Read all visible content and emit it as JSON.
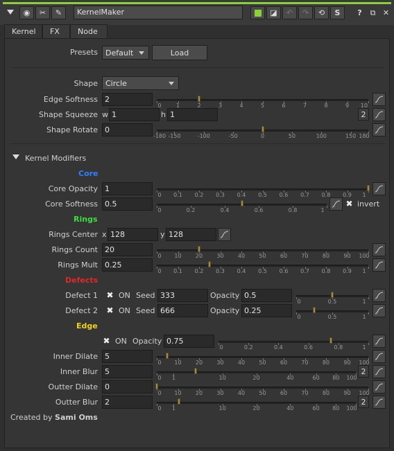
{
  "title_bar": {
    "node_name": "KernelMaker",
    "help": "?",
    "s_label": "S"
  },
  "tabs": [
    "Kernel",
    "FX",
    "Node"
  ],
  "presets": {
    "label": "Presets",
    "value": "Default",
    "load": "Load"
  },
  "shape": {
    "label": "Shape",
    "value": "Circle"
  },
  "edge_softness": {
    "label": "Edge Softness",
    "value": "2",
    "min": 0,
    "max": 10,
    "level": 2,
    "ticks": [
      "0",
      "1",
      "2",
      "3",
      "4",
      "5",
      "6",
      "7",
      "8",
      "9",
      "10"
    ]
  },
  "shape_squeeze": {
    "label": "Shape Squeeze",
    "w_label": "w",
    "w": "1",
    "h_label": "h",
    "h": "1",
    "badge": "2"
  },
  "shape_rotate": {
    "label": "Shape Rotate",
    "value": "0",
    "min": -180,
    "max": 180,
    "level": 0,
    "ticks": [
      "-180",
      "-150",
      "-100",
      "-50",
      "0",
      "50",
      "100",
      "150",
      "180"
    ]
  },
  "kernel_modifiers": "Kernel Modifiers",
  "core": {
    "title": "Core",
    "opacity_label": "Core Opacity",
    "opacity": "1",
    "opacity_level": 1,
    "opacity_ticks": [
      "0",
      "0.1",
      "0.2",
      "0.3",
      "0.4",
      "0.5",
      "0.6",
      "0.7",
      "0.8",
      "0.9",
      "1"
    ],
    "softness_label": "Core Softness",
    "softness": "0.5",
    "softness_level": 0.5,
    "softness_ticks": [
      "0",
      "0.2",
      "0.4",
      "0.6",
      "0.8",
      "1"
    ],
    "invert": "invert"
  },
  "rings": {
    "title": "Rings",
    "center_label": "Rings Center",
    "x_label": "x",
    "x": "128",
    "y_label": "y",
    "y": "128",
    "count_label": "Rings Count",
    "count": "20",
    "count_level": 20,
    "count_ticks": [
      "0",
      "10",
      "20",
      "30",
      "40",
      "50",
      "60",
      "70",
      "80",
      "90",
      "100"
    ],
    "mult_label": "Rings Mult",
    "mult": "0.25",
    "mult_level": 0.25,
    "mult_ticks": [
      "0",
      "0.1",
      "0.2",
      "0.3",
      "0.4",
      "0.5",
      "0.6",
      "0.7",
      "0.8",
      "0.9",
      "1"
    ]
  },
  "defects": {
    "title": "Defects",
    "rows": [
      {
        "label": "Defect 1",
        "on": "ON",
        "seed_label": "Seed",
        "seed": "333",
        "opacity_label": "Opacity",
        "opacity": "0.5",
        "level": 0.5
      },
      {
        "label": "Defect 2",
        "on": "ON",
        "seed_label": "Seed",
        "seed": "666",
        "opacity_label": "Opacity",
        "opacity": "0.25",
        "level": 0.25
      }
    ],
    "ticks": [
      "0",
      "0.5",
      "1"
    ]
  },
  "edge": {
    "title": "Edge",
    "on": "ON",
    "opacity_label": "Opacity",
    "opacity": "0.75",
    "opacity_level": 0.75,
    "opacity_ticks": [
      "0",
      "0.2",
      "0.4",
      "0.6",
      "0.8",
      "1"
    ],
    "inner_dilate_label": "Inner Dilate",
    "inner_dilate": "5",
    "inner_dilate_level": 5,
    "inner_blur_label": "Inner Blur",
    "inner_blur": "5",
    "inner_blur_level": 5,
    "outter_dilate_label": "Outter Dilate",
    "outter_dilate": "0",
    "outter_dilate_level": 0,
    "outter_blur_label": "Outter Blur",
    "outter_blur": "2",
    "outter_blur_level": 2,
    "lin_ticks": [
      "0",
      "10",
      "20",
      "30",
      "40",
      "50",
      "60",
      "70",
      "80",
      "90",
      "100"
    ],
    "log_ticks": [
      "0",
      "1",
      "10",
      "20",
      "40",
      "60",
      "80",
      "100"
    ],
    "badge": "2"
  },
  "footer": {
    "prefix": "Created by",
    "author": "Sami Oms"
  },
  "colors": {
    "core": "#2f7fff",
    "rings": "#3fdc3f",
    "defects": "#e02828",
    "edge": "#f2d21c",
    "accent": "#8bd23a"
  }
}
